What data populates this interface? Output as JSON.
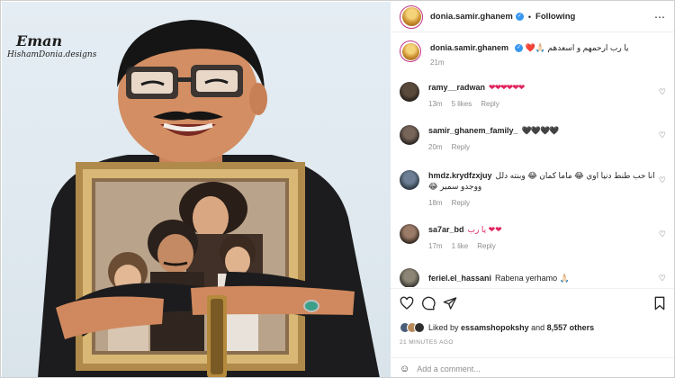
{
  "watermark": {
    "name": "Eman",
    "credit": "HishamDonia.designs"
  },
  "post": {
    "author": "donia.samir.ghanem",
    "follow_state": "Following",
    "caption_text": "يا رب ارحمهم و اسعدهم",
    "caption_emoji": "❤️🙏🏻",
    "caption_time": "21m"
  },
  "comments": [
    {
      "user": "ramy__radwan",
      "text": "❤❤❤❤❤❤",
      "time": "13m",
      "likes": "5 likes",
      "reply": "Reply",
      "heart_color": "red"
    },
    {
      "user": "samir_ghanem_family_",
      "text": "🖤🖤🖤🖤",
      "time": "20m",
      "likes": "",
      "reply": "Reply",
      "heart_color": "black"
    },
    {
      "user": "hmdz.krydfzxjuy",
      "text": "انا حب طنط دنيا اوي 😂 ماما كمان 😂 وبنته دلل ووجدو سمير 😂",
      "time": "18m",
      "likes": "",
      "reply": "Reply"
    },
    {
      "user": "sa7ar_bd",
      "text": "يا رب ❤❤",
      "time": "17m",
      "likes": "1 like",
      "reply": "Reply"
    },
    {
      "user": "feriel.el_hassani",
      "text": "Rabena yerhamo 🙏🏻",
      "time": "",
      "likes": "",
      "reply": ""
    }
  ],
  "likes": {
    "prefix": "Liked by",
    "user": "essamshopokshy",
    "joiner": "and",
    "count": "8,557 others"
  },
  "timestamp": "21 MINUTES AGO",
  "comment_input": {
    "placeholder": "Add a comment..."
  },
  "icons": {
    "like": "heart-outline-icon",
    "comment": "comment-bubble-icon",
    "share": "paper-plane-icon",
    "save": "bookmark-icon",
    "emoji": "smiley-icon",
    "more": "more-dots-icon",
    "verified": "verified-badge-icon"
  },
  "colors": {
    "verified": "#3897f0",
    "heart": "#e0245e",
    "story_ring": "#c13584",
    "muted": "#8e8e8e"
  }
}
